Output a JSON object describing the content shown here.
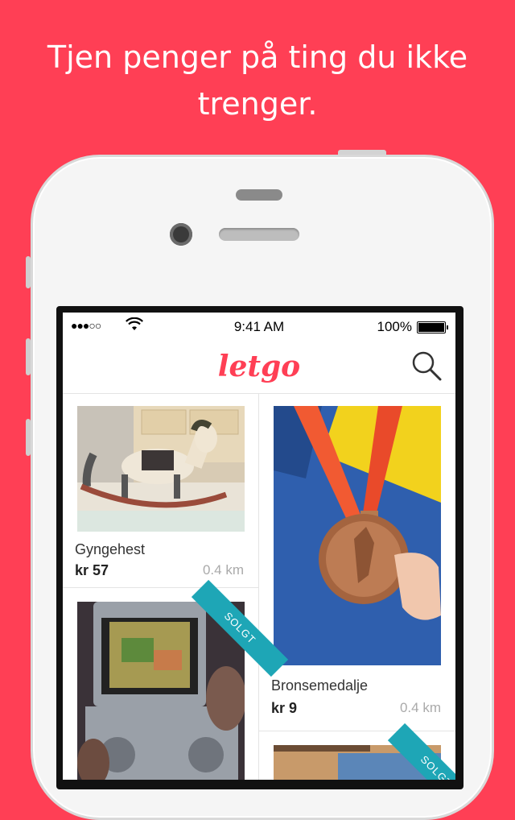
{
  "headline": {
    "line1": "Tjen penger på ting du ikke",
    "line2": "trenger."
  },
  "status_bar": {
    "signal": "●●●○○",
    "time": "9:41 AM",
    "battery": "100%"
  },
  "app": {
    "logo": "letgo",
    "search_icon": "search-icon"
  },
  "listings": [
    {
      "title": "Gyngehest",
      "price": "kr 57",
      "distance": "0.4 km",
      "sold": false
    },
    {
      "title": "Bronsemedalje",
      "price": "kr 9",
      "distance": "0.4 km",
      "sold": false
    },
    {
      "title": "",
      "price": "",
      "distance": "",
      "sold": true,
      "badge": "SOLGT"
    },
    {
      "title": "",
      "price": "",
      "distance": "",
      "sold": true,
      "badge": "SOLGT"
    }
  ],
  "colors": {
    "brand": "#ff3f55",
    "sold_ribbon": "#1ea6b6"
  }
}
